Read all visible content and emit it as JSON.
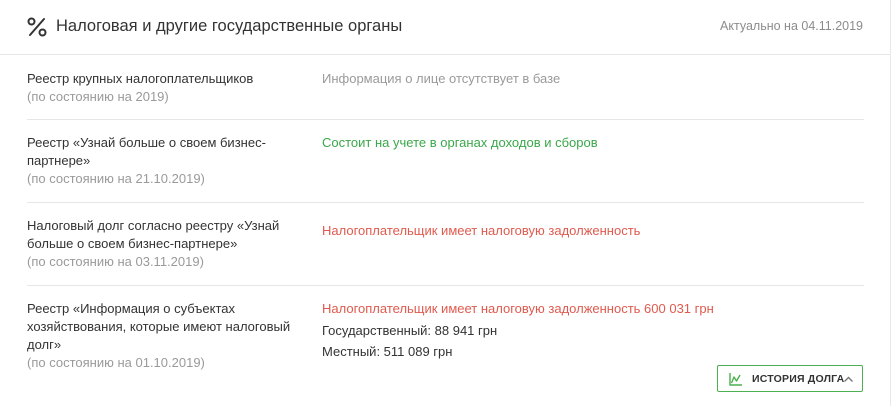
{
  "header": {
    "icon": "percent-icon",
    "title": "Налоговая и другие государственные органы",
    "updated": "Актуально на 04.11.2019"
  },
  "rows": [
    {
      "label": "Реестр крупных налогоплательщиков",
      "date": "(по состоянию на 2019)",
      "value": "Информация о лице отсутствует в базе",
      "status_color": "#9a9a9a"
    },
    {
      "label": "Реестр «Узнай больше о своем бизнес-партнере»",
      "date": "(по состоянию на 21.10.2019)",
      "value": "Состоит на учете в органах доходов и сборов",
      "status_color": "#3aa84a"
    },
    {
      "label": "Налоговый долг согласно реестру «Узнай больше о своем бизнес-партнере»",
      "date": "(по состоянию на 03.11.2019)",
      "value": "Налогоплательщик имеет налоговую задолженность",
      "status_color": "#e05a4e"
    },
    {
      "label": "Реестр «Информация о субъектах хозяйствования, которые имеют налоговый долг»",
      "date": "(по состоянию на 01.10.2019)",
      "value": "Налогоплательщик имеет налоговую задолженность 600 031 грн",
      "status_color": "#e05a4e",
      "state_debt": "Государственный: 88 941 грн",
      "local_debt": "Местный: 511 089 грн"
    }
  ],
  "history_button": {
    "label": "ИСТОРИЯ ДОЛГА",
    "icon": "chart-line-icon",
    "chevron": "chevron-up-icon",
    "accent": "#4caf50"
  }
}
